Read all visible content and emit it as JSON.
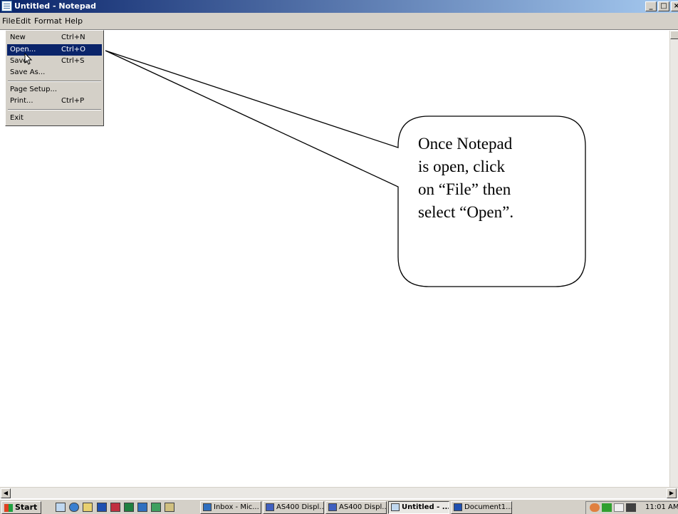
{
  "window": {
    "title": "Untitled - Notepad",
    "caption_buttons": [
      "_",
      "□",
      "×"
    ]
  },
  "menubar": {
    "items": [
      "File",
      "Edit",
      "Format",
      "Help"
    ]
  },
  "file_menu": {
    "items": [
      {
        "label": "New",
        "shortcut": "Ctrl+N"
      },
      {
        "label": "Open...",
        "shortcut": "Ctrl+O"
      },
      {
        "label": "Save",
        "shortcut": "Ctrl+S"
      },
      {
        "label": "Save As...",
        "shortcut": ""
      },
      {
        "label": "Page Setup...",
        "shortcut": ""
      },
      {
        "label": "Print...",
        "shortcut": "Ctrl+P"
      },
      {
        "label": "Exit",
        "shortcut": ""
      }
    ],
    "highlighted": "Open..."
  },
  "callout": {
    "text": "Once Notepad\nis open, click\non “File” then\nselect “Open”."
  },
  "taskbar": {
    "start_label": "Start",
    "buttons": [
      {
        "label": "Inbox - Mic...",
        "icon": "outlook-icon"
      },
      {
        "label": "AS400 Displ...",
        "icon": "ibm-icon"
      },
      {
        "label": "AS400 Displ...",
        "icon": "ibm-icon"
      },
      {
        "label": "Untitled - ...",
        "icon": "notepad-icon",
        "active": true
      },
      {
        "label": "Document1...",
        "icon": "word-icon"
      }
    ],
    "clock": "11:01 AM"
  },
  "colors": {
    "titlebar_start": "#0a246a",
    "titlebar_end": "#a6caf0",
    "menu_highlight": "#0a246a",
    "face": "#d4d0c8"
  }
}
